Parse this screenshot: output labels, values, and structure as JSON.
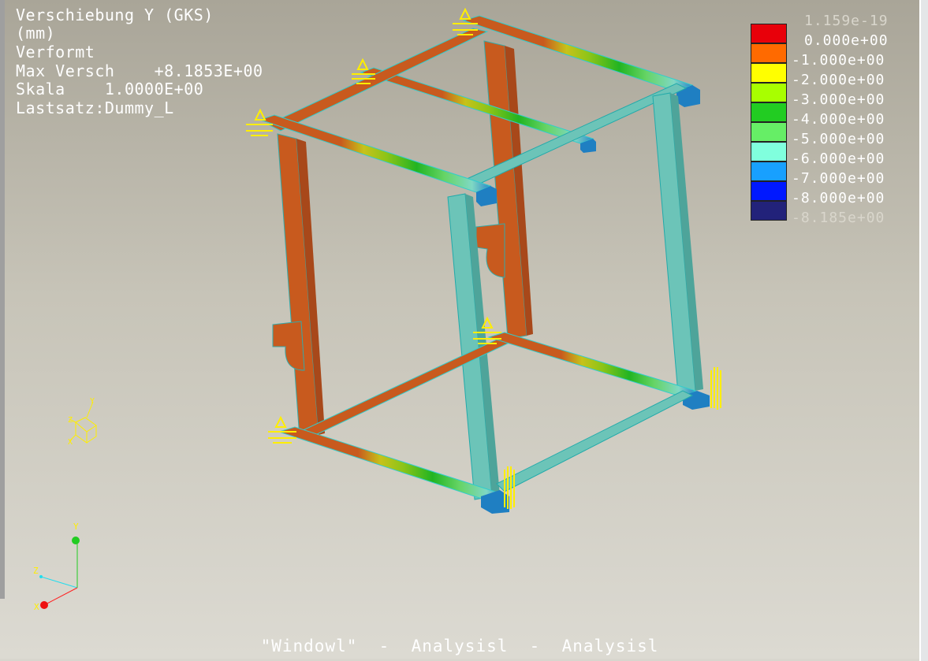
{
  "window": {
    "footer_title": "\"Windowl\"  -  Analysisl  -  Analysisl"
  },
  "info": {
    "lines": [
      "Verschiebung Y (GKS)",
      "(mm)",
      "Verformt",
      "Max Versch    +8.1853E+00",
      "Skala    1.0000E+00",
      "Lastsatz:Dummy_L"
    ]
  },
  "legend": {
    "entries": [
      {
        "label": "1.159e-19",
        "color": "#e8000a"
      },
      {
        "label": "0.000e+00",
        "color": "#ff6a00"
      },
      {
        "label": "-1.000e+00",
        "color": "#ffff00"
      },
      {
        "label": "-2.000e+00",
        "color": "#a8ff00"
      },
      {
        "label": "-3.000e+00",
        "color": "#22cc22"
      },
      {
        "label": "-4.000e+00",
        "color": "#66ee66"
      },
      {
        "label": "-5.000e+00",
        "color": "#80ffdd"
      },
      {
        "label": "-6.000e+00",
        "color": "#18a0ff"
      },
      {
        "label": "-7.000e+00",
        "color": "#0018ff"
      },
      {
        "label": "-8.000e+00",
        "color": "#22227a"
      },
      {
        "label": "-8.185e+00",
        "color": null
      }
    ]
  },
  "axes": {
    "x": "X",
    "y": "Y",
    "z": "Z"
  },
  "colors": {
    "orange_member": "#c85a1e",
    "teal_member": "#6cc4b8",
    "constraint": "#ffee00"
  }
}
